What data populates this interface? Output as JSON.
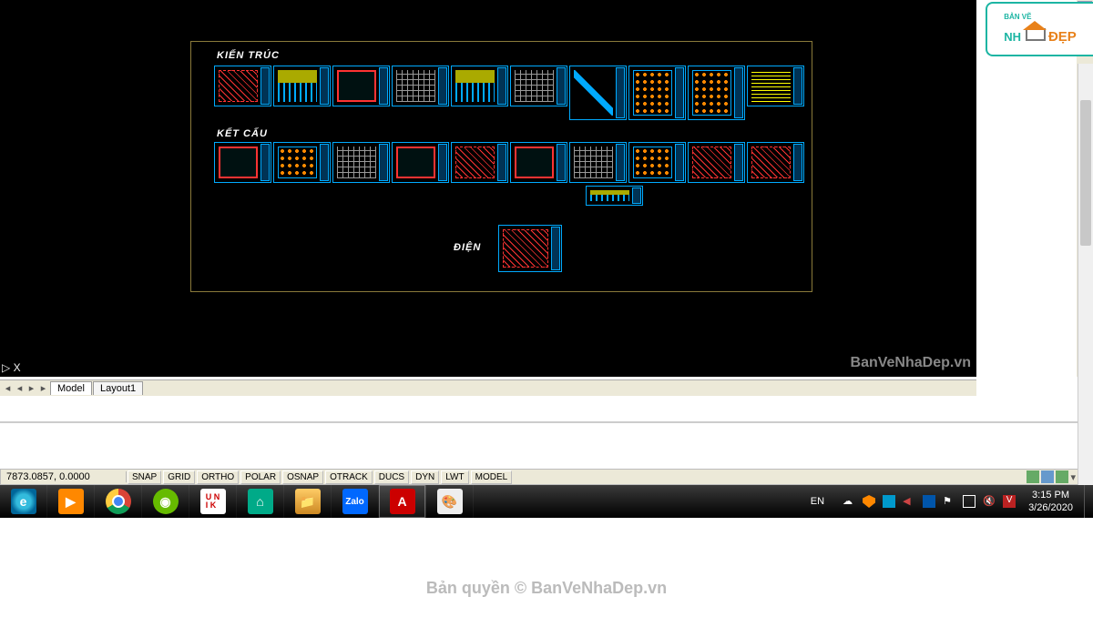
{
  "drawing": {
    "section1_label": "KIẾN TRÚC",
    "section2_label": "KẾT CẤU",
    "section3_label": "ĐIỆN"
  },
  "watermark_canvas": "BanVeNhaDep.vn",
  "watermark_page": "Bản quyền © BanVeNhaDep.vn",
  "logo": {
    "line1_a": "BẢN VẼ",
    "line2_a": "NH",
    "line2_b": "ĐẸP"
  },
  "ucs_cursor": "▷  X",
  "tabs": {
    "model": "Model",
    "layout1": "Layout1"
  },
  "status": {
    "coords": "7873.0857, 0.0000",
    "buttons": [
      "SNAP",
      "GRID",
      "ORTHO",
      "POLAR",
      "OSNAP",
      "OTRACK",
      "DUCS",
      "DYN",
      "LWT",
      "MODEL"
    ]
  },
  "tray": {
    "lang": "EN",
    "time": "3:15 PM",
    "date": "3/26/2020"
  }
}
